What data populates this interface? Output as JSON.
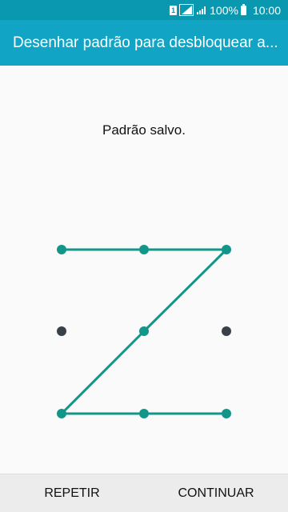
{
  "status_bar": {
    "sim_label": "1",
    "battery_percent": "100%",
    "time": "10:00"
  },
  "app_bar": {
    "title": "Desenhar padrão para desbloquear a..."
  },
  "message": "Padrão salvo.",
  "pattern": {
    "grid_size": 3,
    "selected_color": "#12968a",
    "unselected_color": "#3a4048",
    "selected_dots": [
      1,
      2,
      3,
      5,
      7,
      8,
      9
    ],
    "path_sequence": [
      1,
      2,
      3,
      5,
      7,
      8,
      9
    ]
  },
  "buttons": {
    "left_label": "REPETIR",
    "right_label": "CONTINUAR"
  }
}
